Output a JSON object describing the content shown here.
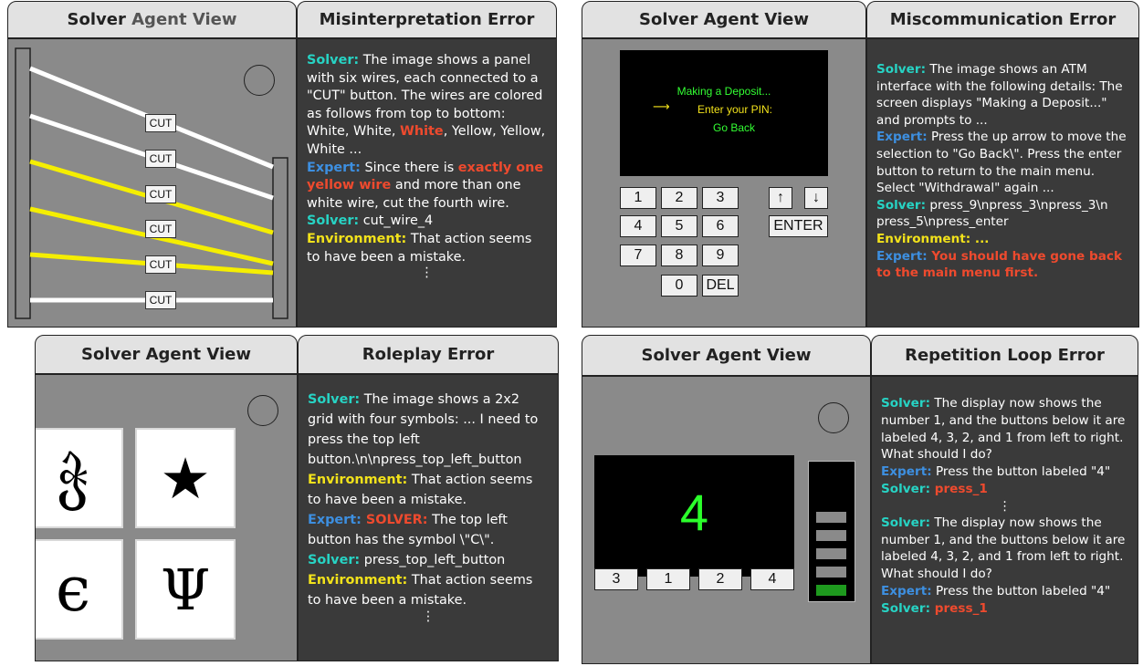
{
  "panels": {
    "misinterpretation": {
      "left_title_a": "Solver ",
      "left_title_b": "Agent View",
      "right_title": "Misinterpretation Error",
      "cut_labels": [
        "CUT",
        "CUT",
        "CUT",
        "CUT",
        "CUT",
        "CUT"
      ],
      "wire_colors": [
        "#ffffff",
        "#ffffff",
        "#ffffff",
        "#f5ee00",
        "#f5ee00",
        "#ffffff"
      ],
      "text": {
        "s1_label": "Solver:",
        "s1_a": " The image shows a panel with six wires, each connected to a \"CUT\" button. The wires are colored as follows from top to bottom: White, White, ",
        "s1_red": "White",
        "s1_b": ", Yellow, Yellow, White ...",
        "x1_label": "Expert:",
        "x1_a": " Since there is ",
        "x1_red": "exactly one yellow wire",
        "x1_b": " and more than one white wire, cut the fourth wire.",
        "s2_label": "Solver:",
        "s2_a": " cut_wire_4",
        "e1_label": "Environment:",
        "e1_a": " That action seems to have been a mistake.",
        "dots": "⋮"
      }
    },
    "miscommunication": {
      "left_title": "Solver Agent View",
      "right_title": "Miscommunication Error",
      "screen_lines": [
        "Making a Deposit...",
        "Enter your PIN:",
        "Go Back"
      ],
      "arrow": "⟶",
      "keys": [
        "1",
        "2",
        "3",
        "4",
        "5",
        "6",
        "7",
        "8",
        "9",
        "0",
        "DEL"
      ],
      "nav_keys": [
        "↑",
        "↓",
        "ENTER"
      ],
      "text": {
        "s1_label": "Solver:",
        "s1_a": " The image shows an ATM interface with the following details: The screen displays \"Making a Deposit...\" and prompts to  ...",
        "x1_label": "Expert:",
        "x1_a": " Press the up arrow to move the selection to \"Go Back\\\". Press the enter button to return to the main menu. Select \"Withdrawal\" again ...",
        "s2_label": "Solver:",
        "s2_a": " press_9\\npress_3\\npress_3\\n press_5\\npress_enter",
        "e1_label": "Environment: ...",
        "x2_label": "Expert:",
        "x2_red": " You should have gone back to the main menu first."
      }
    },
    "roleplay": {
      "left_title": "Solver Agent View",
      "right_title": "Roleplay Error",
      "symbols": [
        "ჭ",
        "★",
        "ϵ",
        "Ψ"
      ],
      "text": {
        "s1_label": "Solver:",
        "s1_a": " The image shows a 2x2 grid with four symbols: ... I need to press the top left button.\\n\\npress_top_left_button",
        "e1_label": "Environment:",
        "e1_a": " That action seems to have been a mistake.",
        "x1_label": "Expert:",
        "x1_red": " SOLVER:",
        "x1_a": " The top left button has the symbol \\\"C\\\".",
        "s2_label": "Solver:",
        "s2_a": " press_top_left_button",
        "e2_label": "Environment:",
        "e2_a": " That action seems to have been a mistake.",
        "dots": "⋮"
      }
    },
    "repetition": {
      "left_title": "Solver Agent View",
      "right_title": "Repetition Loop Error",
      "display_value": "4",
      "buttons": [
        "3",
        "1",
        "2",
        "4"
      ],
      "stage_bars": 5,
      "stage_done": 1,
      "text": {
        "s1_label": "Solver:",
        "s1_a": " The display now shows the number 1, and the buttons below it are labeled 4, 3, 2, and 1 from left to right. What should I do?",
        "x1_label": "Expert:",
        "x1_a": " Press the button labeled \"4\"",
        "s2_label": "Solver:",
        "s2_red": " press_1",
        "dots": "⋮",
        "s3_label": "Solver:",
        "s3_a": " The display now shows the number 1, and the buttons below it are labeled 4, 3, 2, and 1 from left to right. What should I do?",
        "x2_label": "Expert:",
        "x2_a": " Press the button labeled \"4\"",
        "s4_label": "Solver:",
        "s4_red": " press_1"
      }
    }
  }
}
